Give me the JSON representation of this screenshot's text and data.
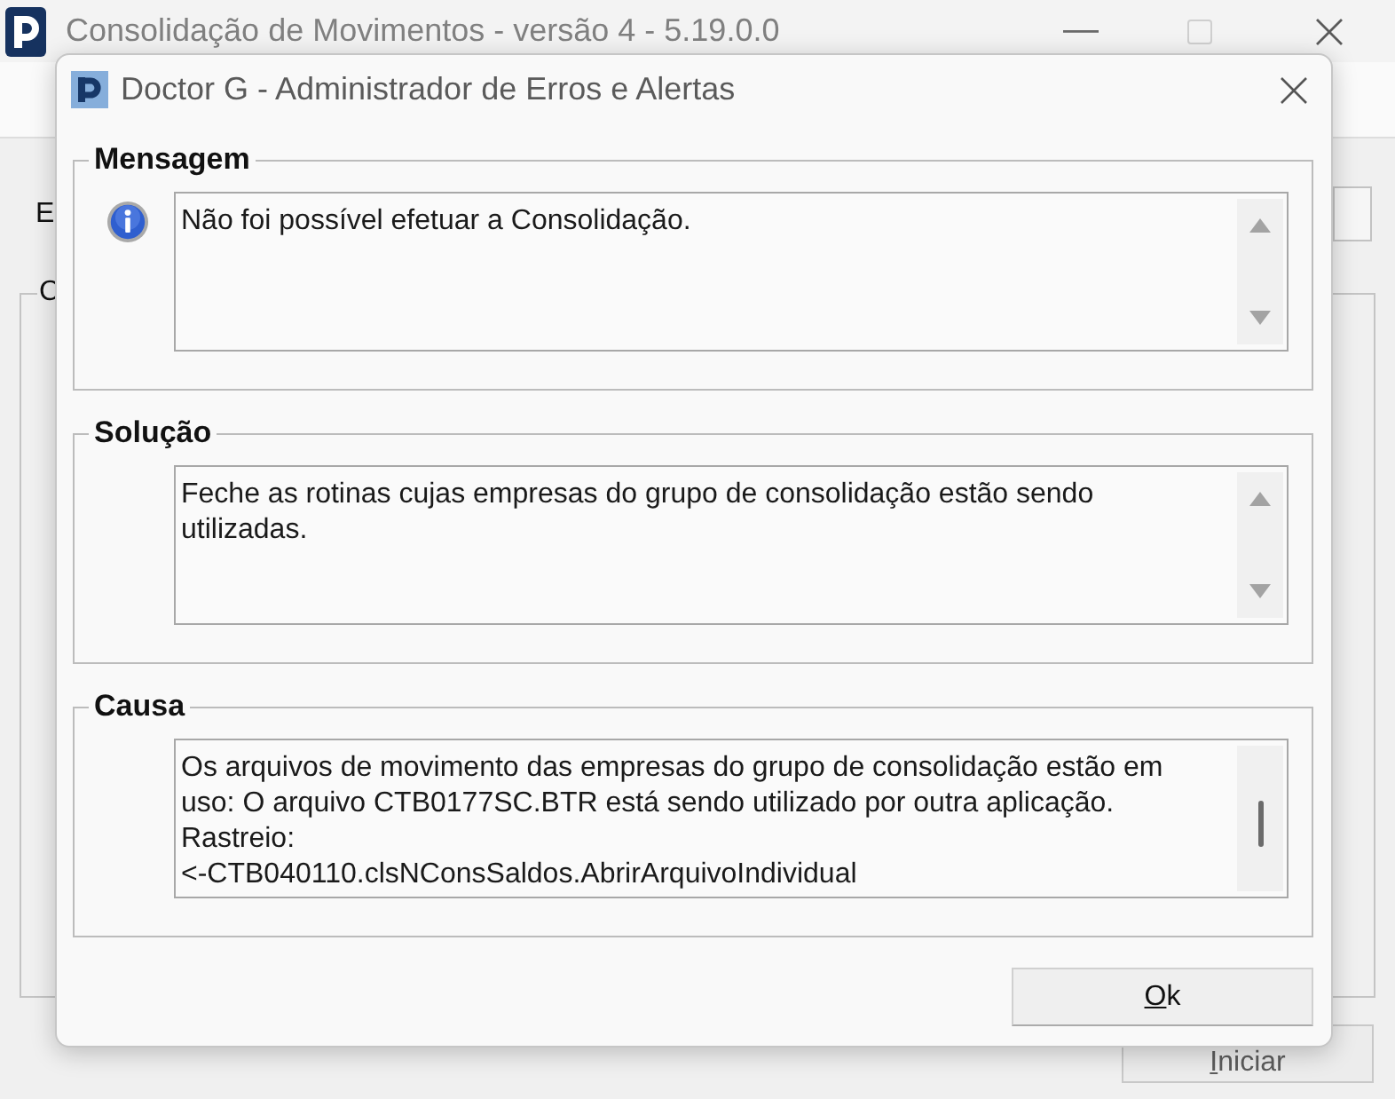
{
  "main_window": {
    "title": "Consolidação de Movimentos - versão 4 - 5.19.0.0",
    "maximize_disabled": true,
    "label_1": "E",
    "group_box_1": {
      "title": "C"
    },
    "start_button": {
      "label": "Iniciar",
      "disabled": true
    }
  },
  "dialog": {
    "title": "Doctor G - Administrador de Erros e Alertas",
    "sections": [
      {
        "kind": "message",
        "title": "Mensagem",
        "text": "Não foi possível efetuar a Consolidação.",
        "scroll_thumb": false
      },
      {
        "kind": "solution",
        "title": "Solução",
        "text": "Feche as rotinas cujas empresas do grupo de consolidação estão sendo utilizadas.",
        "scroll_thumb": false
      },
      {
        "kind": "cause",
        "title": "Causa",
        "text": "Os arquivos de movimento das empresas do grupo de consolidação estão em uso: O arquivo CTB0177SC.BTR está sendo utilizado por outra aplicação.\nRastreio:\n<-CTB040110.clsNConsSaldos.AbrirArquivoIndividual",
        "scroll_thumb": true
      }
    ],
    "ok_button": {
      "label": "Ok"
    }
  }
}
